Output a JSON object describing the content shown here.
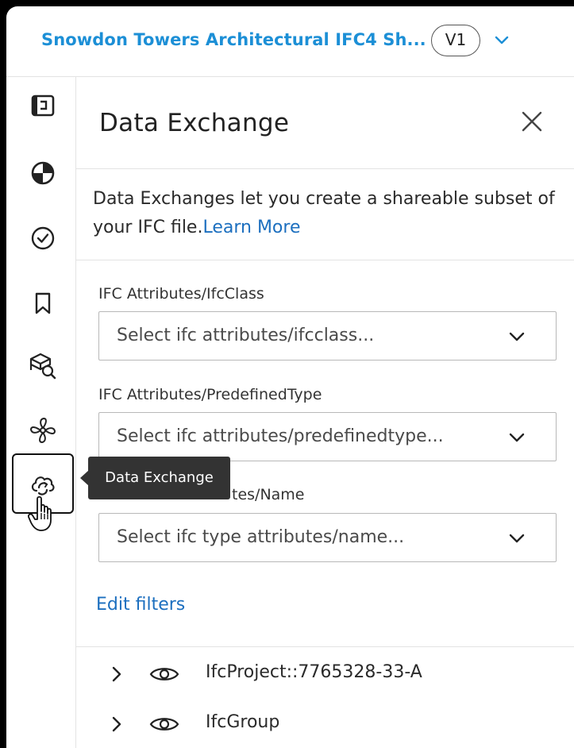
{
  "header": {
    "title": "Snowdon Towers Architectural IFC4 Sh...",
    "version": "V1"
  },
  "rail": {
    "items": [
      {
        "icon": "sheets-icon"
      },
      {
        "icon": "model-browser-icon"
      },
      {
        "icon": "issues-check-icon"
      },
      {
        "icon": "bookmark-icon"
      },
      {
        "icon": "model-search-icon"
      },
      {
        "icon": "fan-icon"
      },
      {
        "icon": "data-exchange-icon",
        "active": true
      }
    ]
  },
  "tooltip": {
    "text": "Data Exchange"
  },
  "panel": {
    "title": "Data Exchange",
    "description": "Data Exchanges let you create a shareable subset of your IFC file.",
    "learn_more": "Learn More",
    "filters": [
      {
        "label": "IFC Attributes/IfcClass",
        "placeholder": "Select ifc attributes/ifcclass..."
      },
      {
        "label": "IFC Attributes/PredefinedType",
        "placeholder": "Select ifc attributes/predefinedtype..."
      },
      {
        "label": "IFC Type Attributes/Name",
        "label_visible": "tes/Name",
        "placeholder": "Select ifc type attributes/name..."
      }
    ],
    "edit_filters": "Edit filters",
    "tree": [
      {
        "label": "IfcProject::7765328-33-A"
      },
      {
        "label": "IfcGroup"
      }
    ]
  },
  "colors": {
    "accent": "#1c8fd6",
    "link": "#1c6fbf",
    "tooltip_bg": "#333333"
  }
}
